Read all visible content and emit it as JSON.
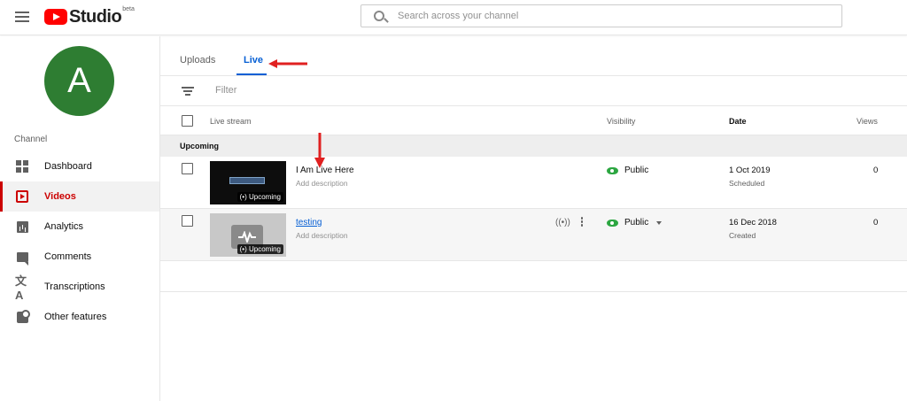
{
  "header": {
    "brand": "Studio",
    "brand_tag": "beta",
    "search_placeholder": "Search across your channel"
  },
  "sidebar": {
    "avatar_letter": "A",
    "section_label": "Channel",
    "items": [
      {
        "label": "Dashboard",
        "icon": "dashboard-icon",
        "active": false
      },
      {
        "label": "Videos",
        "icon": "videos-icon",
        "active": true
      },
      {
        "label": "Analytics",
        "icon": "analytics-icon",
        "active": false
      },
      {
        "label": "Comments",
        "icon": "comments-icon",
        "active": false
      },
      {
        "label": "Transcriptions",
        "icon": "translate-icon",
        "active": false
      },
      {
        "label": "Other features",
        "icon": "other-features-icon",
        "active": false
      }
    ]
  },
  "tabs": [
    {
      "label": "Uploads",
      "active": false
    },
    {
      "label": "Live",
      "active": true
    }
  ],
  "filter": {
    "placeholder": "Filter"
  },
  "table": {
    "columns": {
      "stream": "Live stream",
      "visibility": "Visibility",
      "date": "Date",
      "views": "Views"
    },
    "group_label": "Upcoming",
    "rows": [
      {
        "title": "I Am Live Here",
        "description": "Add description",
        "badge": "(•) Upcoming",
        "visibility": "Public",
        "date": "1 Oct 2019",
        "date_status": "Scheduled",
        "views": "0"
      },
      {
        "title": "testing",
        "description": "Add description",
        "badge": "(•) Upcoming",
        "visibility": "Public",
        "date": "16 Dec 2018",
        "date_status": "Created",
        "views": "0",
        "live_icon": "((•))"
      }
    ]
  },
  "colors": {
    "accent_red": "#cc0000",
    "link_blue": "#065fd4",
    "public_green": "#2ba640",
    "avatar_green": "#2e7d32",
    "annotation_arrow": "#e02020"
  }
}
